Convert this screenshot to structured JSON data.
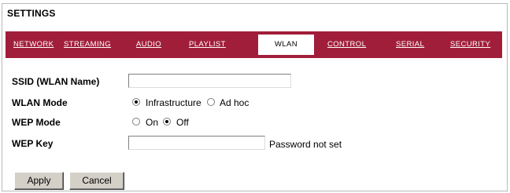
{
  "page": {
    "title": "SETTINGS"
  },
  "tabs": [
    {
      "label": "NETWORK",
      "active": false
    },
    {
      "label": "STREAMING",
      "active": false
    },
    {
      "label": "AUDIO",
      "active": false
    },
    {
      "label": "PLAYLIST",
      "active": false
    },
    {
      "label": "WLAN",
      "active": true
    },
    {
      "label": "CONTROL",
      "active": false
    },
    {
      "label": "SERIAL",
      "active": false
    },
    {
      "label": "SECURITY",
      "active": false
    }
  ],
  "form": {
    "ssid": {
      "label": "SSID (WLAN Name)",
      "value": ""
    },
    "wlan_mode": {
      "label": "WLAN Mode",
      "options": [
        "Infrastructure",
        "Ad hoc"
      ],
      "selected": "Infrastructure"
    },
    "wep_mode": {
      "label": "WEP Mode",
      "options": [
        "On",
        "Off"
      ],
      "selected": "Off"
    },
    "wep_key": {
      "label": "WEP Key",
      "value": "",
      "status": "Password not set"
    }
  },
  "buttons": {
    "apply": "Apply",
    "cancel": "Cancel"
  },
  "colors": {
    "tab_bar": "#a11e3a",
    "tab_text": "#ffffff",
    "button_face": "#d4d0c8"
  }
}
